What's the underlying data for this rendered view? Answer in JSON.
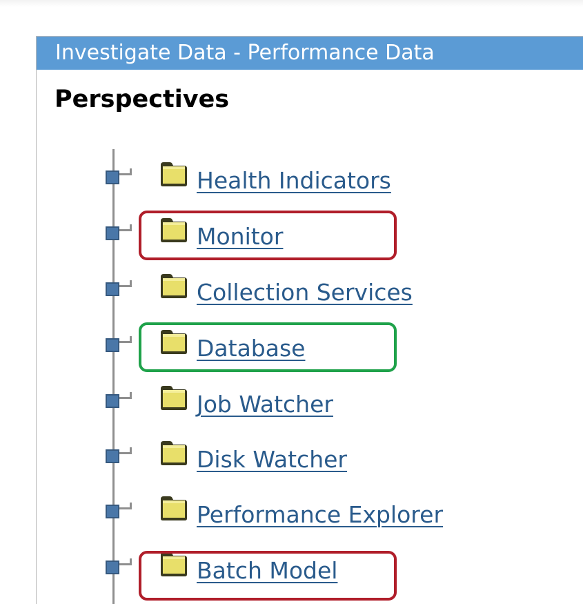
{
  "panel": {
    "title": "Investigate Data - Performance Data"
  },
  "section": {
    "heading": "Perspectives"
  },
  "tree": {
    "items": [
      {
        "label": "Health Indicators"
      },
      {
        "label": "Monitor"
      },
      {
        "label": "Collection Services"
      },
      {
        "label": "Database"
      },
      {
        "label": "Job Watcher"
      },
      {
        "label": "Disk Watcher"
      },
      {
        "label": "Performance Explorer"
      },
      {
        "label": "Batch Model"
      }
    ]
  },
  "annotations": {
    "red_color": "#b01e2a",
    "green_color": "#1fa24a",
    "highlighted_red": [
      "Monitor",
      "Batch Model"
    ],
    "highlighted_green": [
      "Database"
    ]
  },
  "colors": {
    "title_bar": "#5b9bd5",
    "link": "#2a5b8c",
    "folder": "#e8df6a",
    "expander": "#4a77a8"
  }
}
